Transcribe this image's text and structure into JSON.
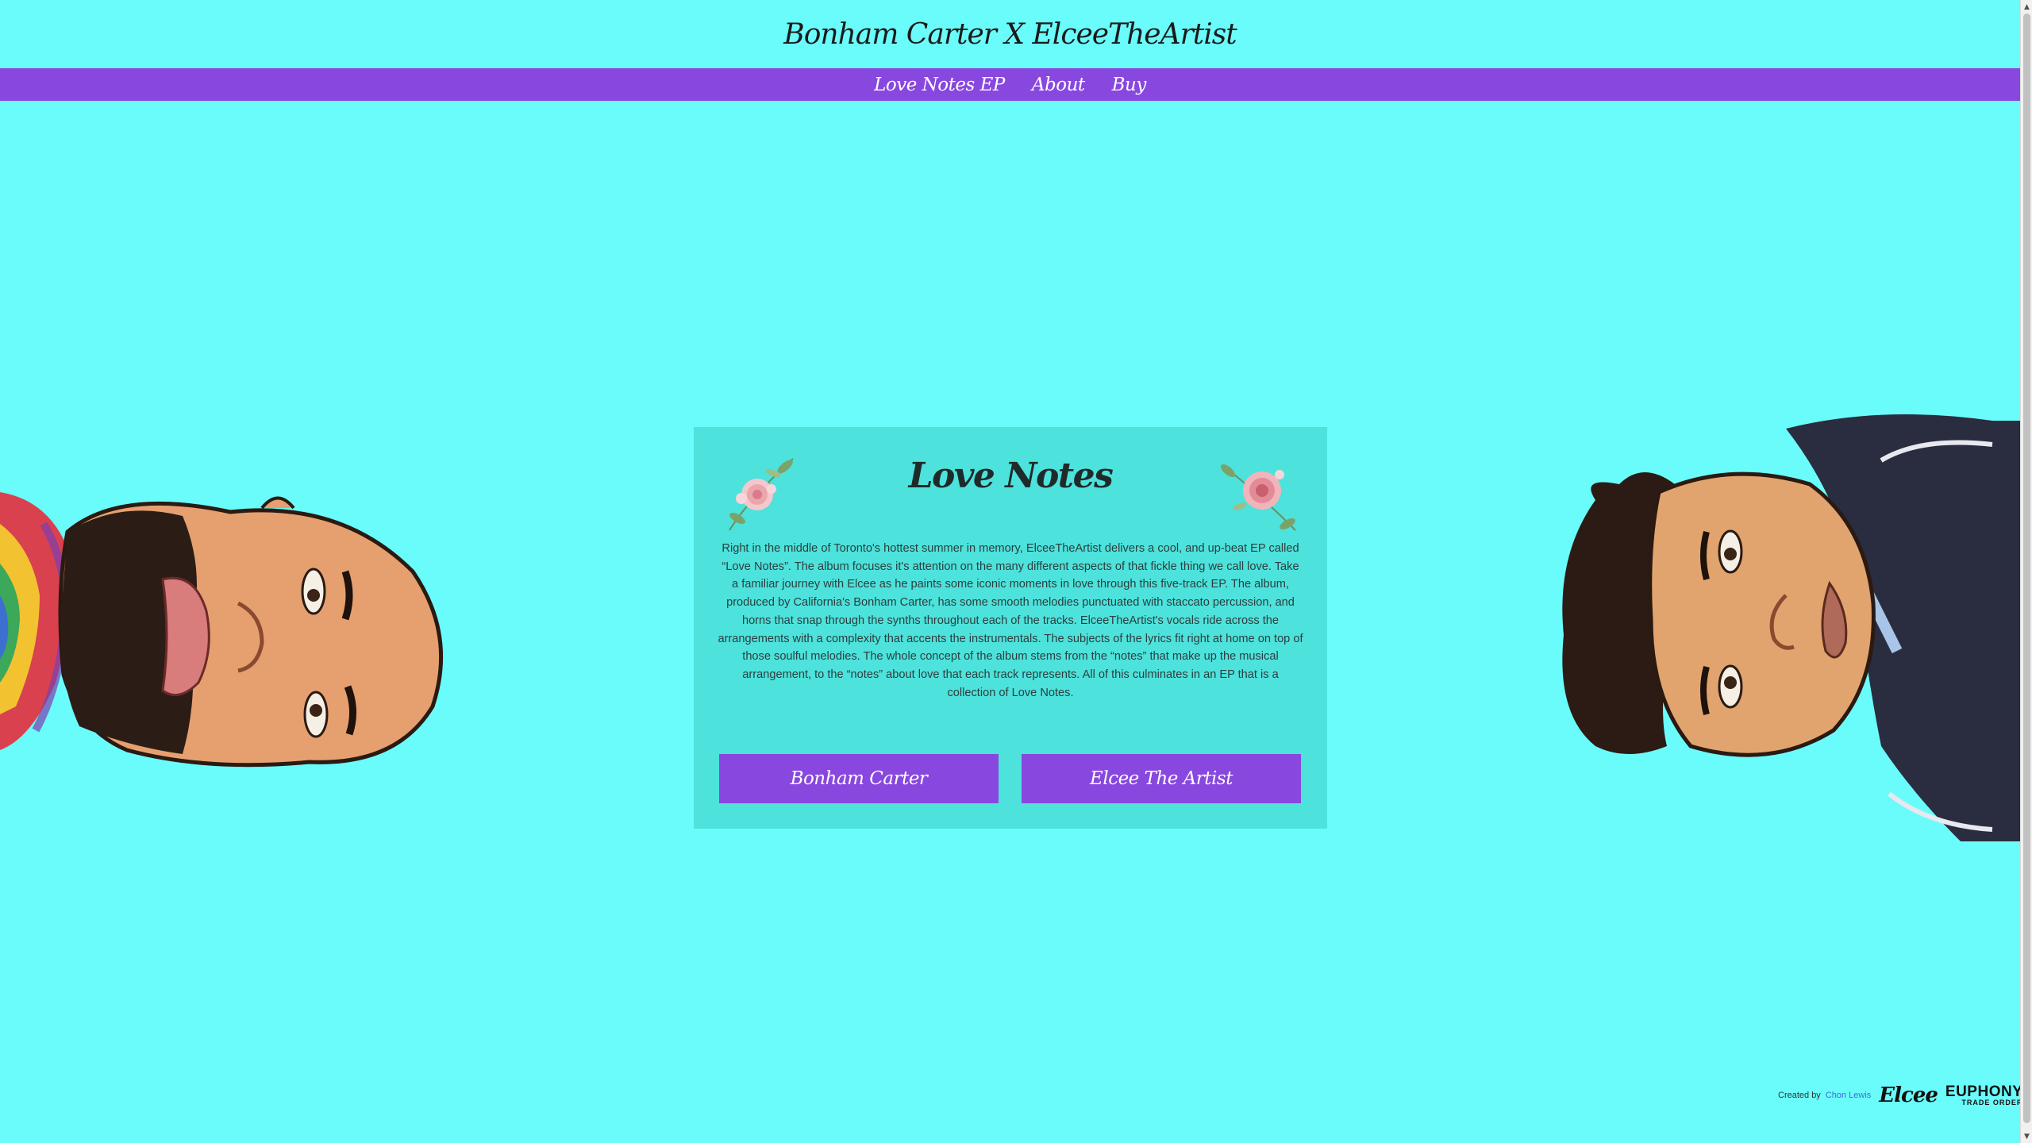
{
  "header": {
    "site_title": "Bonham Carter X ElceeTheArtist"
  },
  "nav": {
    "items": [
      {
        "label": "Love Notes EP"
      },
      {
        "label": "About"
      },
      {
        "label": "Buy"
      }
    ]
  },
  "card": {
    "title": "Love Notes",
    "body": "Right in the middle of Toronto's hottest summer in memory, ElceeTheArtist delivers a cool, and up-beat EP called “Love Notes”. The album focuses it's attention on the many different aspects of that fickle thing we call love. Take a familiar journey with Elcee as he paints some iconic moments in love through this five-track EP. The album, produced by California's Bonham Carter, has some smooth melodies punctuated with staccato percussion, and horns that snap through the synths throughout each of the tracks. ElceeTheArtist's vocals ride across the arrangements with a complexity that accents the instrumentals. The subjects of the lyrics fit right at home on top of those soulful melodies. The whole concept of the album stems from the “notes” that make up the musical arrangement, to the “notes” about love that each track represents. All of this culminates in an EP that is a collection of Love Notes.",
    "button_left": "Bonham Carter",
    "button_right": "Elcee The Artist"
  },
  "footer": {
    "created_by": "Created by",
    "author": "Chon Lewis",
    "logo_script": "Elcee",
    "logo_main": "EUPHONY",
    "logo_sub": "TRADE ORDER"
  },
  "colors": {
    "background": "#6afcfb",
    "nav_bar": "#8847de",
    "card": "#4de2dc",
    "button": "#8847de"
  }
}
